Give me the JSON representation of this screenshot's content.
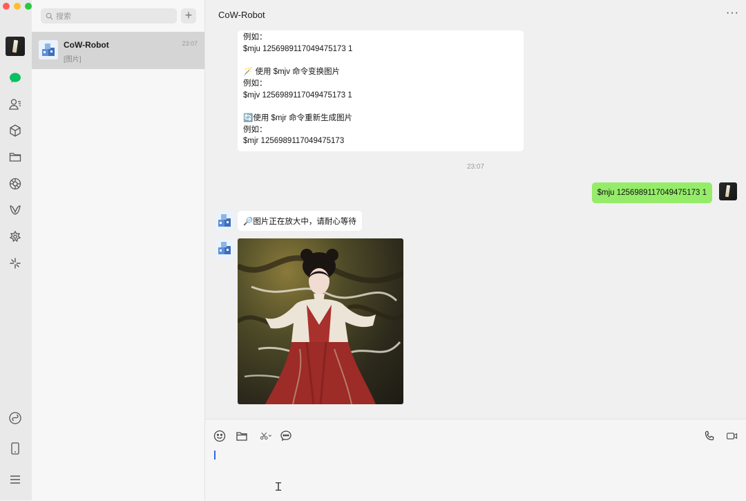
{
  "app": {
    "search_placeholder": "搜索",
    "new_chat_symbol": "+"
  },
  "colors": {
    "accent_green": "#07c160",
    "bubble_green": "#95ec69",
    "traffic_red": "#fe5f57",
    "traffic_yellow": "#febc2e",
    "traffic_green": "#28c840"
  },
  "conversations": [
    {
      "name": "CoW-Robot",
      "preview": "[图片]",
      "time": "23:07"
    }
  ],
  "chat": {
    "title": "CoW-Robot",
    "more_symbol": "···",
    "bot_message_lines": [
      "例如：",
      "$mju 1256989117049475173 1",
      "",
      "🪄 使用 $mjv 命令变换图片",
      "例如：",
      "$mjv 1256989117049475173 1",
      "",
      "🔄使用 $mjr 命令重新生成图片",
      "例如：",
      "$mjr 1256989117049475173"
    ],
    "timestamp": "23:07",
    "user_message": "$mju 1256989117049475173 1",
    "notice_message": "🔎图片正在放大中，请耐心等待"
  },
  "icons": {
    "rail": [
      "chat-icon",
      "contacts-icon",
      "cube-icon",
      "folder-icon",
      "moments-icon",
      "channels-icon",
      "mini-program-icon",
      "search-spark-icon",
      "mini-program-bottom-icon",
      "phone-icon",
      "menu-icon"
    ],
    "composer": [
      "emoji-icon",
      "file-icon",
      "scissors-icon",
      "chat-history-icon",
      "voice-call-icon",
      "video-call-icon"
    ]
  }
}
